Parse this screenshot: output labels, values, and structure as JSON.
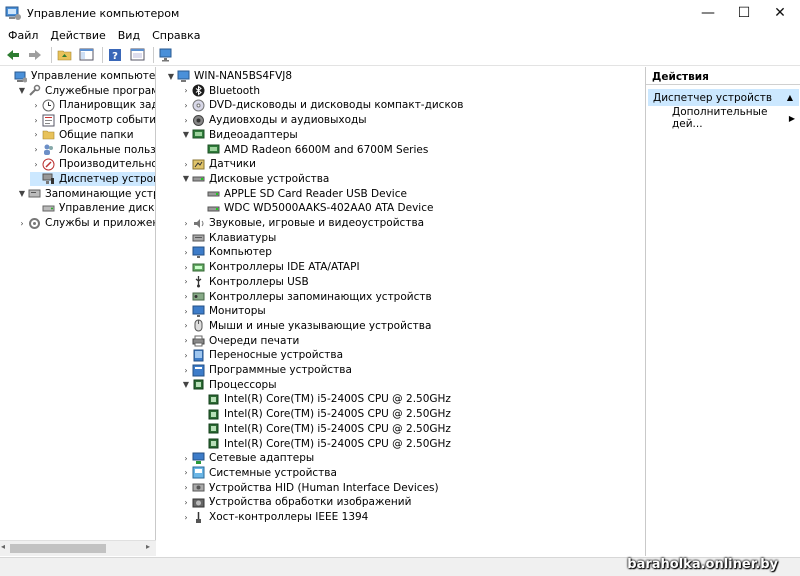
{
  "window": {
    "title": "Управление компьютером",
    "minimize": "—",
    "maximize": "☐",
    "close": "✕"
  },
  "menu": [
    "Файл",
    "Действие",
    "Вид",
    "Справка"
  ],
  "left_tree": [
    {
      "label": "Управление компьютером (л",
      "level": 0,
      "exp": "",
      "icon": "computer-management-icon"
    },
    {
      "label": "Служебные программы",
      "level": 1,
      "exp": "▼",
      "icon": "tools-icon"
    },
    {
      "label": "Планировщик заданий",
      "level": 2,
      "exp": "›",
      "icon": "clock-icon"
    },
    {
      "label": "Просмотр событий",
      "level": 2,
      "exp": "›",
      "icon": "event-viewer-icon"
    },
    {
      "label": "Общие папки",
      "level": 2,
      "exp": "›",
      "icon": "shared-folder-icon"
    },
    {
      "label": "Локальные пользовате",
      "level": 2,
      "exp": "›",
      "icon": "users-icon"
    },
    {
      "label": "Производительность",
      "level": 2,
      "exp": "›",
      "icon": "performance-icon"
    },
    {
      "label": "Диспетчер устройств",
      "level": 2,
      "exp": "",
      "icon": "device-manager-icon",
      "selected": true
    },
    {
      "label": "Запоминающие устройст",
      "level": 1,
      "exp": "▼",
      "icon": "storage-icon"
    },
    {
      "label": "Управление дисками",
      "level": 2,
      "exp": "",
      "icon": "disk-icon"
    },
    {
      "label": "Службы и приложения",
      "level": 1,
      "exp": "›",
      "icon": "services-icon"
    }
  ],
  "device_tree": [
    {
      "label": "WIN-NAN5BS4FVJ8",
      "level": 0,
      "exp": "▼",
      "icon": "computer-icon",
      "root": true
    },
    {
      "label": "Bluetooth",
      "level": 1,
      "exp": "›",
      "icon": "bluetooth-icon"
    },
    {
      "label": "DVD-дисководы и дисководы компакт-дисков",
      "level": 1,
      "exp": "›",
      "icon": "dvd-icon"
    },
    {
      "label": "Аудиовходы и аудиовыходы",
      "level": 1,
      "exp": "›",
      "icon": "audio-icon"
    },
    {
      "label": "Видеоадаптеры",
      "level": 1,
      "exp": "▼",
      "icon": "display-adapter-icon"
    },
    {
      "label": "AMD Radeon 6600M and 6700M Series",
      "level": 2,
      "exp": "",
      "icon": "display-adapter-icon"
    },
    {
      "label": "Датчики",
      "level": 1,
      "exp": "›",
      "icon": "sensor-icon"
    },
    {
      "label": "Дисковые устройства",
      "level": 1,
      "exp": "▼",
      "icon": "disk-drive-icon"
    },
    {
      "label": "APPLE SD Card Reader USB Device",
      "level": 2,
      "exp": "",
      "icon": "disk-drive-icon"
    },
    {
      "label": "WDC WD5000AAKS-402AA0 ATA Device",
      "level": 2,
      "exp": "",
      "icon": "disk-drive-icon"
    },
    {
      "label": "Звуковые, игровые и видеоустройства",
      "level": 1,
      "exp": "›",
      "icon": "sound-icon"
    },
    {
      "label": "Клавиатуры",
      "level": 1,
      "exp": "›",
      "icon": "keyboard-icon"
    },
    {
      "label": "Компьютер",
      "level": 1,
      "exp": "›",
      "icon": "monitor-icon"
    },
    {
      "label": "Контроллеры IDE ATA/ATAPI",
      "level": 1,
      "exp": "›",
      "icon": "ide-icon"
    },
    {
      "label": "Контроллеры USB",
      "level": 1,
      "exp": "›",
      "icon": "usb-icon"
    },
    {
      "label": "Контроллеры запоминающих устройств",
      "level": 1,
      "exp": "›",
      "icon": "storage-controller-icon"
    },
    {
      "label": "Мониторы",
      "level": 1,
      "exp": "›",
      "icon": "monitor-icon"
    },
    {
      "label": "Мыши и иные указывающие устройства",
      "level": 1,
      "exp": "›",
      "icon": "mouse-icon"
    },
    {
      "label": "Очереди печати",
      "level": 1,
      "exp": "›",
      "icon": "printer-icon"
    },
    {
      "label": "Переносные устройства",
      "level": 1,
      "exp": "›",
      "icon": "portable-device-icon"
    },
    {
      "label": "Программные устройства",
      "level": 1,
      "exp": "›",
      "icon": "software-device-icon"
    },
    {
      "label": "Процессоры",
      "level": 1,
      "exp": "▼",
      "icon": "processor-icon"
    },
    {
      "label": "Intel(R) Core(TM) i5-2400S CPU @ 2.50GHz",
      "level": 2,
      "exp": "",
      "icon": "processor-icon"
    },
    {
      "label": "Intel(R) Core(TM) i5-2400S CPU @ 2.50GHz",
      "level": 2,
      "exp": "",
      "icon": "processor-icon"
    },
    {
      "label": "Intel(R) Core(TM) i5-2400S CPU @ 2.50GHz",
      "level": 2,
      "exp": "",
      "icon": "processor-icon"
    },
    {
      "label": "Intel(R) Core(TM) i5-2400S CPU @ 2.50GHz",
      "level": 2,
      "exp": "",
      "icon": "processor-icon"
    },
    {
      "label": "Сетевые адаптеры",
      "level": 1,
      "exp": "›",
      "icon": "network-adapter-icon"
    },
    {
      "label": "Системные устройства",
      "level": 1,
      "exp": "›",
      "icon": "system-device-icon"
    },
    {
      "label": "Устройства HID (Human Interface Devices)",
      "level": 1,
      "exp": "›",
      "icon": "hid-icon"
    },
    {
      "label": "Устройства обработки изображений",
      "level": 1,
      "exp": "›",
      "icon": "camera-icon"
    },
    {
      "label": "Хост-контроллеры IEEE 1394",
      "level": 1,
      "exp": "›",
      "icon": "ieee1394-icon"
    }
  ],
  "actions": {
    "header": "Действия",
    "section": "Диспетчер устройств",
    "more": "Дополнительные дей..."
  },
  "watermark": "baraholka.onliner.by"
}
